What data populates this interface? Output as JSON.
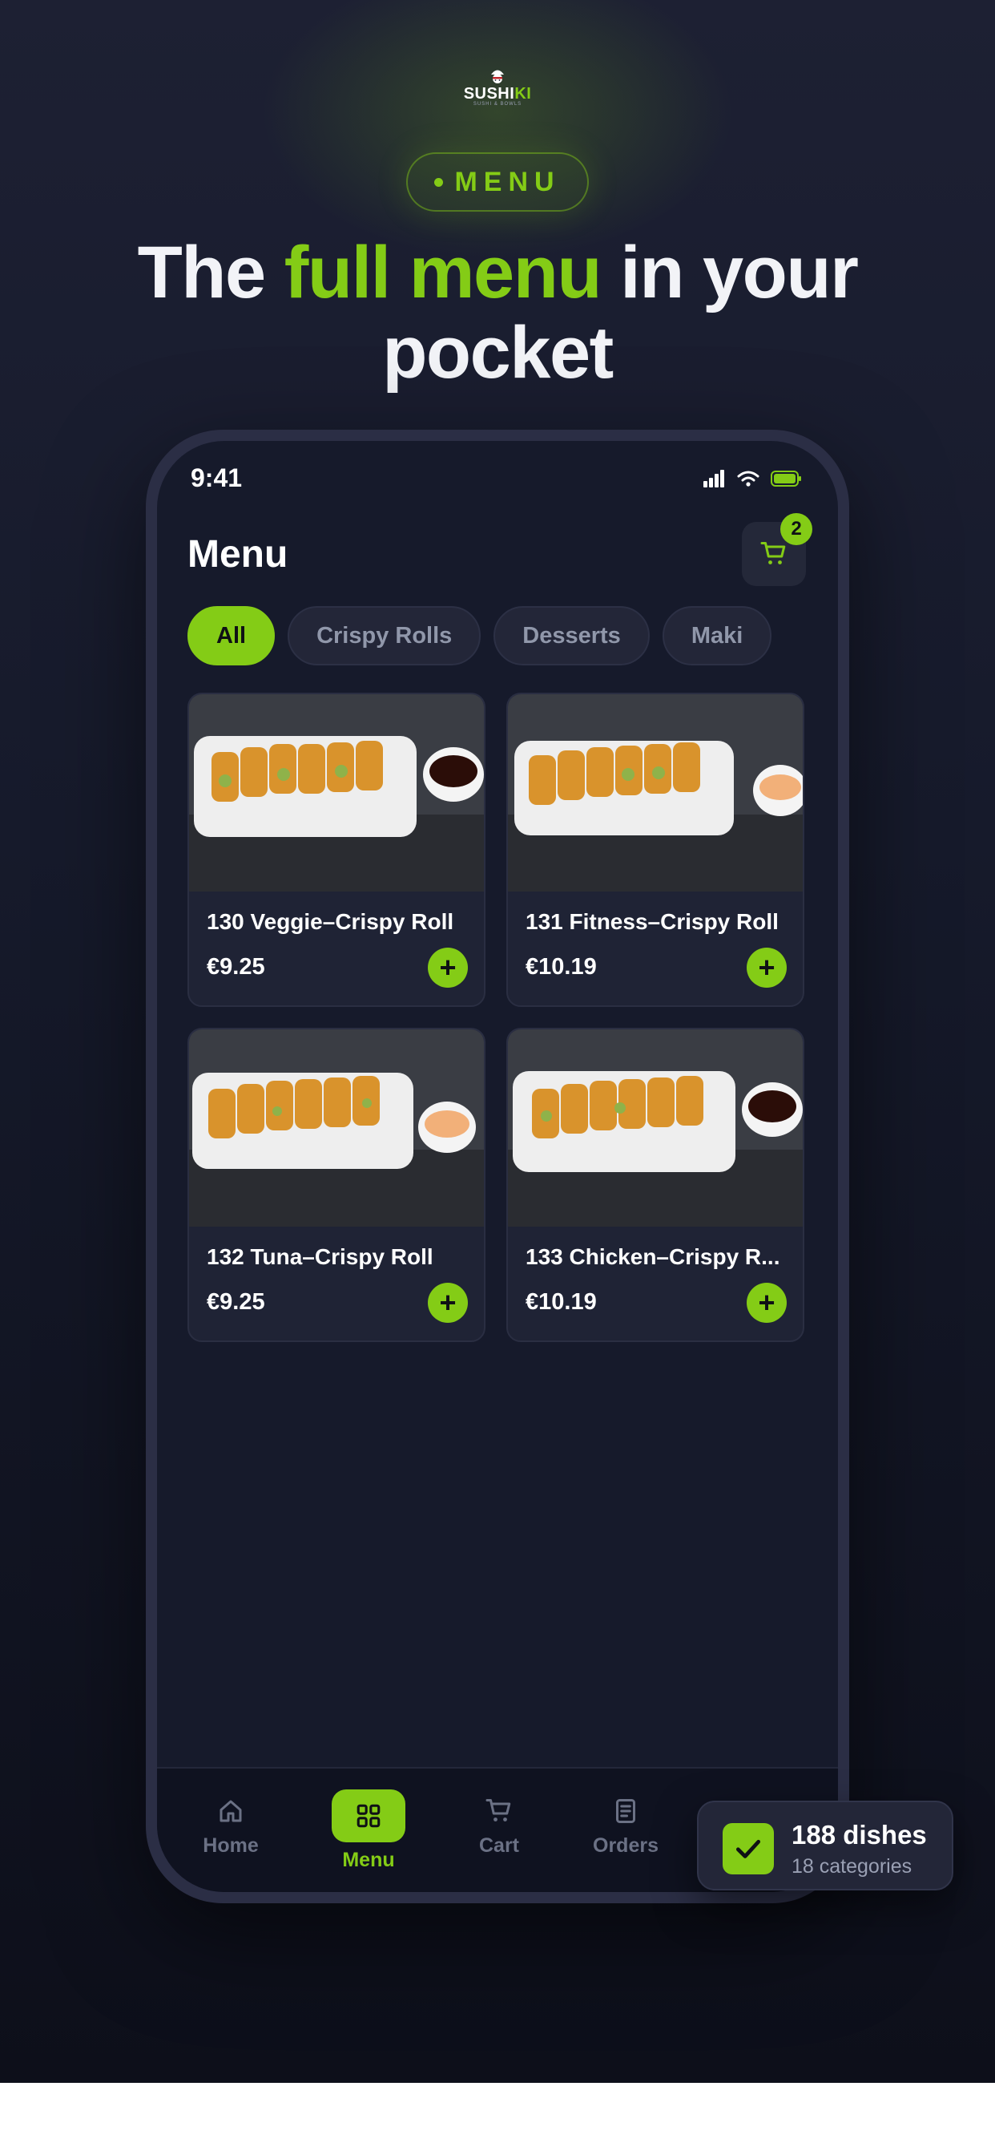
{
  "brand": {
    "name_part1": "SUSHI",
    "name_part2": "KI",
    "tagline": "SUSHI & BOWLS",
    "accent_color": "#84cc16"
  },
  "section_pill": {
    "label": "MENU"
  },
  "headline": {
    "part1": "The ",
    "highlight": "full menu",
    "part2": " in your pocket"
  },
  "phone": {
    "status_bar": {
      "time": "9:41",
      "icons": [
        "signal-icon",
        "wifi-icon",
        "battery-icon"
      ]
    },
    "header": {
      "title": "Menu",
      "cart_icon": "cart-icon",
      "cart_count": "2"
    },
    "categories": [
      {
        "label": "All",
        "active": true
      },
      {
        "label": "Crispy Rolls",
        "active": false
      },
      {
        "label": "Desserts",
        "active": false
      },
      {
        "label": "Maki",
        "active": false
      }
    ],
    "dishes": [
      {
        "name": "130 Veggie–Crispy Roll",
        "price": "€9.25",
        "add_label": "+"
      },
      {
        "name": "131 Fitness–Crispy Roll",
        "price": "€10.19",
        "add_label": "+"
      },
      {
        "name": "132 Tuna–Crispy Roll",
        "price": "€9.25",
        "add_label": "+"
      },
      {
        "name": "133 Chicken–Crispy R...",
        "price": "€10.19",
        "add_label": "+"
      }
    ],
    "tab_bar": [
      {
        "label": "Home",
        "icon": "home-icon",
        "active": false
      },
      {
        "label": "Menu",
        "icon": "grid-icon",
        "active": true
      },
      {
        "label": "Cart",
        "icon": "cart-icon",
        "active": false
      },
      {
        "label": "Orders",
        "icon": "receipt-icon",
        "active": false
      }
    ]
  },
  "toast": {
    "title": "188 dishes",
    "subtitle": "18 categories",
    "icon": "check-icon"
  }
}
